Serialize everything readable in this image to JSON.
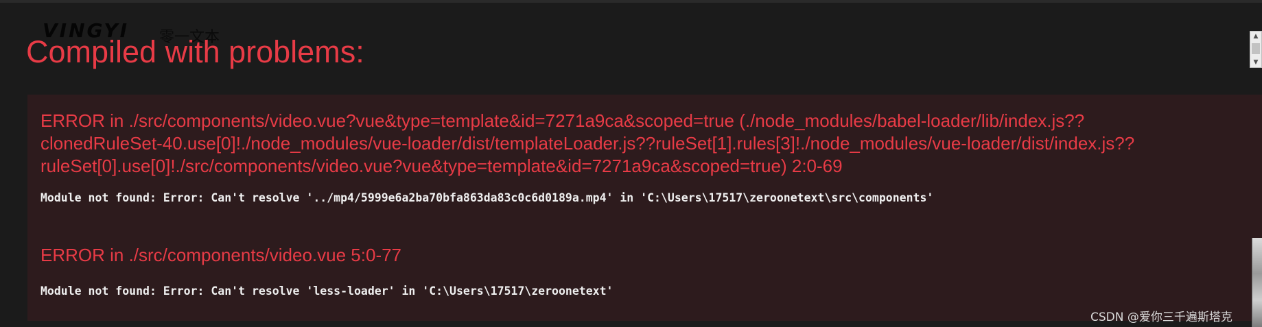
{
  "overlay": {
    "background_logo": {
      "mark": "VINGYI",
      "text": "零一文本"
    },
    "title": "Compiled with problems:",
    "errors": [
      {
        "heading": "ERROR in ./src/components/video.vue?vue&type=template&id=7271a9ca&scoped=true (./node_modules/babel-loader/lib/index.js??\nclonedRuleSet-40.use[0]!./node_modules/vue-loader/dist/templateLoader.js??ruleSet[1].rules[3]!./node_modules/vue-loader/dist/index.js??\nruleSet[0].use[0]!./src/components/video.vue?vue&type=template&id=7271a9ca&scoped=true) 2:0-69",
        "message": "Module not found: Error: Can't resolve '../mp4/5999e6a2ba70bfa863da83c0c6d0189a.mp4' in 'C:\\Users\\17517\\zeroonetext\\src\\components'"
      },
      {
        "heading": "ERROR in ./src/components/video.vue 5:0-77",
        "message": "Module not found: Error: Can't resolve 'less-loader' in 'C:\\Users\\17517\\zeroonetext'"
      }
    ]
  },
  "watermark": "CSDN @爱你三千遍斯塔克",
  "colors": {
    "overlay_background": "#1b1b1b",
    "error_panel_background": "#2d1b1d",
    "error_red": "#e83b46",
    "message_text": "#efefef"
  },
  "icons": {
    "scroll_up": "scroll-up-arrow-icon",
    "scroll_down": "scroll-down-arrow-icon"
  }
}
